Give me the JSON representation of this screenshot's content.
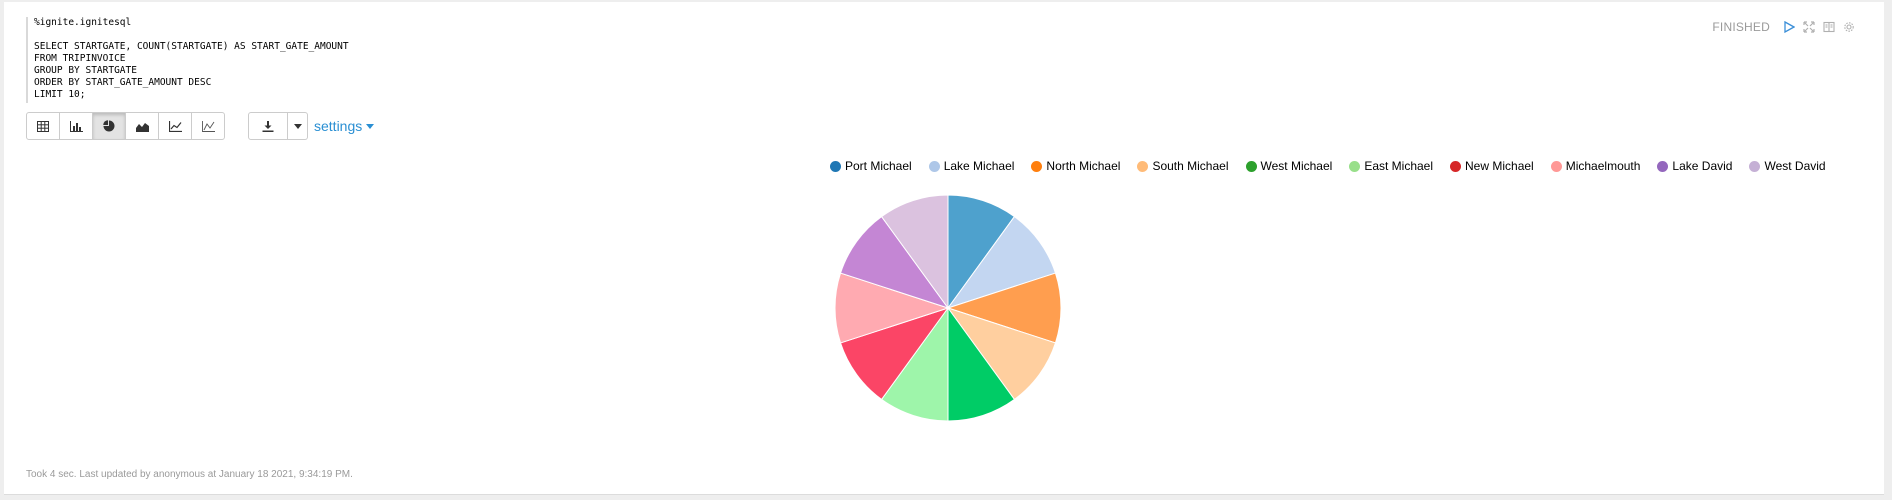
{
  "editor": {
    "lines": [
      "%ignite.ignitesql",
      "",
      "SELECT STARTGATE, COUNT(STARTGATE) AS START_GATE_AMOUNT",
      "FROM TRIPINVOICE",
      "GROUP BY STARTGATE",
      "ORDER BY START_GATE_AMOUNT DESC",
      "LIMIT 10;"
    ]
  },
  "status": {
    "text": "FINISHED",
    "icons": [
      "play-icon",
      "expand-icon",
      "book-icon",
      "gear-icon"
    ]
  },
  "toolbar": {
    "buttons": [
      "table-icon",
      "bar-chart-icon",
      "pie-chart-icon",
      "area-chart-icon",
      "line-chart-icon",
      "scatter-chart-icon"
    ],
    "active": "pie-chart-icon",
    "settings_label": "settings"
  },
  "footer": {
    "text": "Took 4 sec. Last updated by anonymous at January 18 2021, 9:34:19 PM."
  },
  "chart_data": {
    "type": "pie",
    "categories": [
      "Port Michael",
      "Lake Michael",
      "North Michael",
      "South Michael",
      "West Michael",
      "East Michael",
      "New Michael",
      "Michaelmouth",
      "Lake David",
      "West David"
    ],
    "values": [
      1,
      1,
      1,
      1,
      1,
      1,
      1,
      1,
      1,
      1
    ],
    "legend_colors": [
      "#1f77b4",
      "#aec7e8",
      "#ff7f0e",
      "#ffbb78",
      "#2ca02c",
      "#98df8a",
      "#d62728",
      "#ff9896",
      "#9467bd",
      "#c5b0d5"
    ],
    "slice_colors": [
      "#4ea1cd",
      "#c3d6f1",
      "#ff9e4f",
      "#ffcf9f",
      "#00cc66",
      "#9ef5aa",
      "#fb4566",
      "#ffaab1",
      "#c486d4",
      "#dbc2df"
    ],
    "legend_position": "top"
  }
}
